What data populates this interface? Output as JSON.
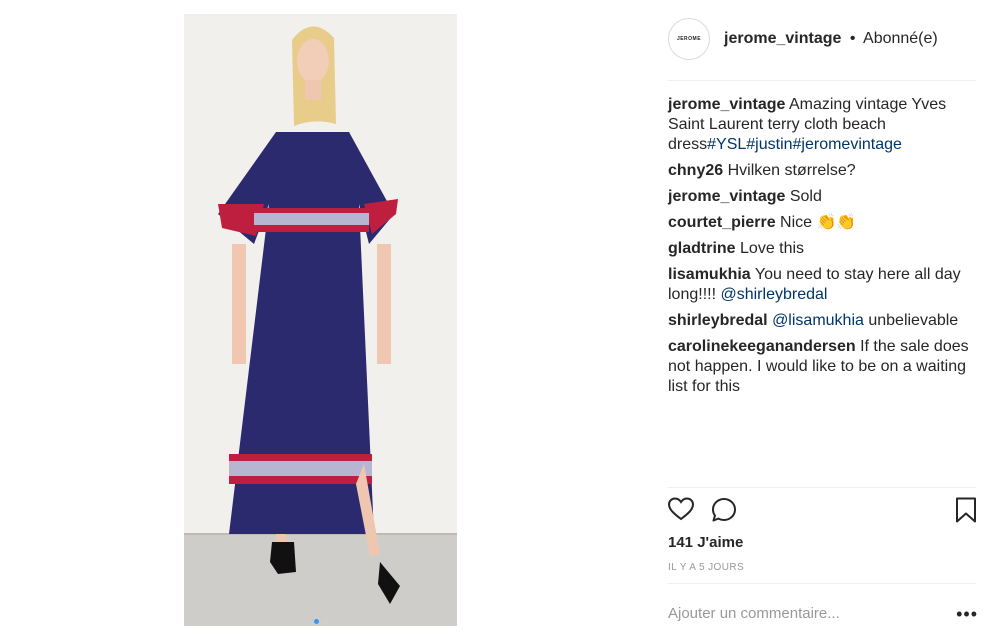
{
  "post": {
    "image_alt": "Woman wearing a navy dress with red and white striped bands",
    "carousel_active": 0
  },
  "header": {
    "avatar_text": "JEROME",
    "username": "jerome_vintage",
    "separator": "•",
    "follow_status": "Abonné(e)"
  },
  "caption": {
    "username": "jerome_vintage",
    "text": "Amazing vintage Yves Saint Laurent terry cloth beach dress",
    "hashtags": [
      "#YSL",
      "#justin",
      "#jeromevintage"
    ]
  },
  "comments": [
    {
      "user": "chny26",
      "text": "Hvilken størrelse?"
    },
    {
      "user": "jerome_vintage",
      "text": "Sold"
    },
    {
      "user": "courtet_pierre",
      "text": "Nice 👏👏"
    },
    {
      "user": "gladtrine",
      "text": "Love this"
    },
    {
      "user": "lisamukhia",
      "text": "You need to stay here all day long!!!!",
      "mention": "@shirleybredal"
    },
    {
      "user": "shirleybredal",
      "mention_first": "@lisamukhia",
      "text": "unbelievable"
    },
    {
      "user": "carolinekeegan­andersen",
      "text": "If the sale does not happen. I would like to be on a waiting list for this"
    }
  ],
  "stats": {
    "likes": "141 J'aime",
    "time_ago": "IL Y A 5 JOURS"
  },
  "comment_box": {
    "placeholder": "Ajouter un commentaire...",
    "more_label": "•••"
  },
  "icons": [
    "heart-icon",
    "comment-icon",
    "bookmark-icon",
    "more-icon"
  ]
}
